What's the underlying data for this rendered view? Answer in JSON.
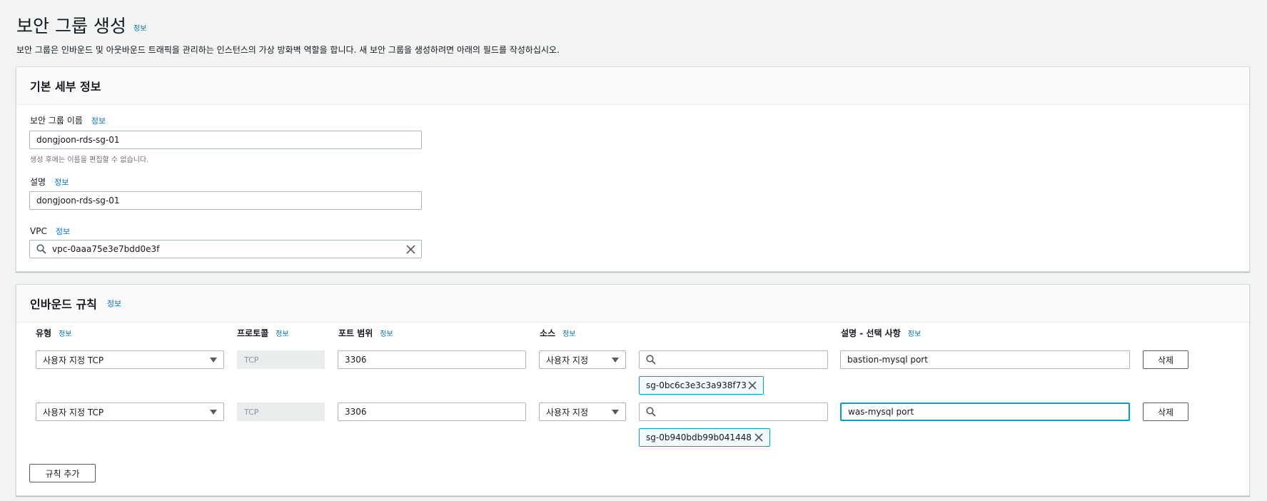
{
  "page": {
    "title": "보안 그룹 생성",
    "title_info": "정보",
    "description": "보안 그룹은 인바운드 및 아웃바운드 트래픽을 관리하는 인스턴스의 가상 방화벽 역할을 합니다. 새 보안 그룹을 생성하려면 아래의 필드를 작성하십시오."
  },
  "basic": {
    "header": "기본 세부 정보",
    "name_label": "보안 그룹 이름",
    "name_info": "정보",
    "name_value": "dongjoon-rds-sg-01",
    "name_constraint": "생성 후에는 이름을 편집할 수 없습니다.",
    "desc_label": "설명",
    "desc_info": "정보",
    "desc_value": "dongjoon-rds-sg-01",
    "vpc_label": "VPC",
    "vpc_info": "정보",
    "vpc_value": "vpc-0aaa75e3e7bdd0e3f"
  },
  "inbound": {
    "header": "인바운드 규칙",
    "header_info": "정보",
    "columns": {
      "type": "유형",
      "protocol": "프로토콜",
      "port": "포트 범위",
      "source": "소스",
      "desc": "설명 - 선택 사항",
      "info": "정보"
    },
    "rules": [
      {
        "type": "사용자 지정 TCP",
        "protocol": "TCP",
        "port": "3306",
        "source_type": "사용자 지정",
        "source_search": "",
        "source_token": "sg-0bc6c3e3c3a938f73",
        "description": "bastion-mysql port",
        "delete": "삭제"
      },
      {
        "type": "사용자 지정 TCP",
        "protocol": "TCP",
        "port": "3306",
        "source_type": "사용자 지정",
        "source_search": "",
        "source_token": "sg-0b940bdb99b041448",
        "description": "was-mysql port",
        "delete": "삭제"
      }
    ],
    "add_rule": "규칙 추가"
  }
}
